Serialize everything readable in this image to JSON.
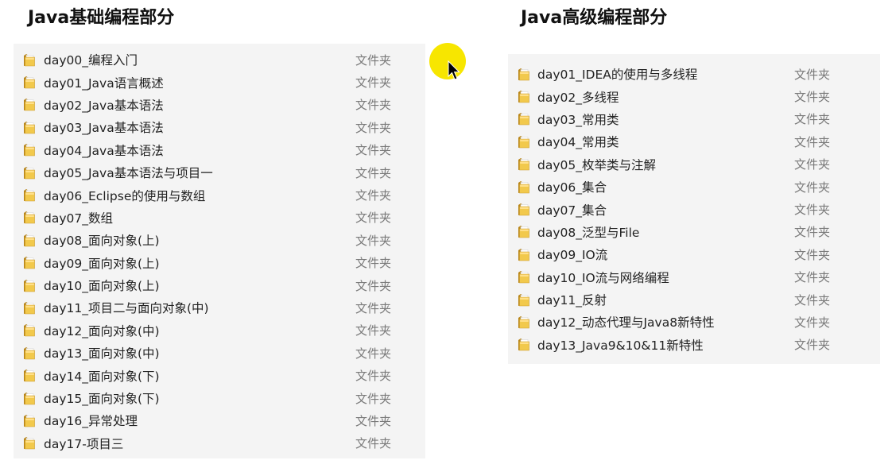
{
  "left_section": {
    "title": "Java基础编程部分",
    "items": [
      {
        "name": "day00_编程入门",
        "type": "文件夹"
      },
      {
        "name": "day01_Java语言概述",
        "type": "文件夹"
      },
      {
        "name": "day02_Java基本语法",
        "type": "文件夹"
      },
      {
        "name": "day03_Java基本语法",
        "type": "文件夹"
      },
      {
        "name": "day04_Java基本语法",
        "type": "文件夹"
      },
      {
        "name": "day05_Java基本语法与项目一",
        "type": "文件夹"
      },
      {
        "name": "day06_Eclipse的使用与数组",
        "type": "文件夹"
      },
      {
        "name": "day07_数组",
        "type": "文件夹"
      },
      {
        "name": "day08_面向对象(上)",
        "type": "文件夹"
      },
      {
        "name": "day09_面向对象(上)",
        "type": "文件夹"
      },
      {
        "name": "day10_面向对象(上)",
        "type": "文件夹"
      },
      {
        "name": "day11_项目二与面向对象(中)",
        "type": "文件夹"
      },
      {
        "name": "day12_面向对象(中)",
        "type": "文件夹"
      },
      {
        "name": "day13_面向对象(中)",
        "type": "文件夹"
      },
      {
        "name": "day14_面向对象(下)",
        "type": "文件夹"
      },
      {
        "name": "day15_面向对象(下)",
        "type": "文件夹"
      },
      {
        "name": "day16_异常处理",
        "type": "文件夹"
      },
      {
        "name": "day17-项目三",
        "type": "文件夹"
      }
    ]
  },
  "right_section": {
    "title": "Java高级编程部分",
    "items": [
      {
        "name": "day01_IDEA的使用与多线程",
        "type": "文件夹"
      },
      {
        "name": "day02_多线程",
        "type": "文件夹"
      },
      {
        "name": "day03_常用类",
        "type": "文件夹"
      },
      {
        "name": "day04_常用类",
        "type": "文件夹"
      },
      {
        "name": "day05_枚举类与注解",
        "type": "文件夹"
      },
      {
        "name": "day06_集合",
        "type": "文件夹"
      },
      {
        "name": "day07_集合",
        "type": "文件夹"
      },
      {
        "name": "day08_泛型与File",
        "type": "文件夹"
      },
      {
        "name": "day09_IO流",
        "type": "文件夹"
      },
      {
        "name": "day10_IO流与网络编程",
        "type": "文件夹"
      },
      {
        "name": "day11_反射",
        "type": "文件夹"
      },
      {
        "name": "day12_动态代理与Java8新特性",
        "type": "文件夹"
      },
      {
        "name": "day13_Java9&10&11新特性",
        "type": "文件夹"
      }
    ]
  },
  "icons": {
    "folder": "folder-icon",
    "cursor": "mouse-pointer-icon"
  },
  "colors": {
    "panel_background": "#f4f4f4",
    "folder_yellow": "#e8b936",
    "cursor_highlight": "#f7e600",
    "type_text": "#7a7a7a"
  }
}
